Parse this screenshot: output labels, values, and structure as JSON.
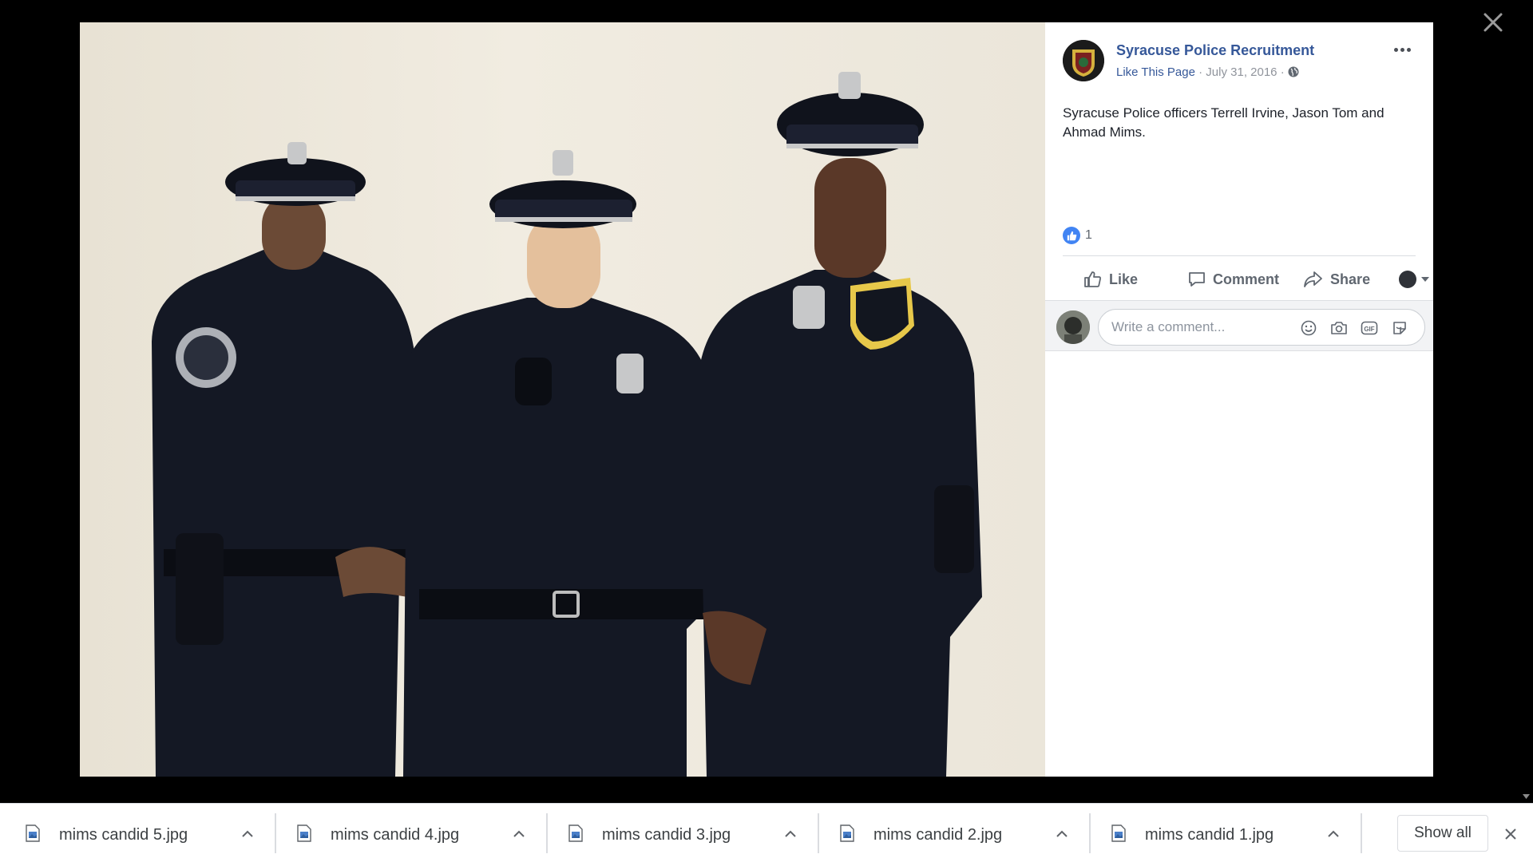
{
  "post": {
    "page_name": "Syracuse Police Recruitment",
    "like_page_label": "Like This Page",
    "separator": " · ",
    "date": "July 31, 2016",
    "caption": "Syracuse Police officers Terrell Irvine, Jason Tom and Ahmad Mims.",
    "reaction_count": "1",
    "actions": {
      "like": "Like",
      "comment": "Comment",
      "share": "Share"
    },
    "comment_placeholder": "Write a comment..."
  },
  "downloads": {
    "items": [
      {
        "name": "mims candid 5.jpg"
      },
      {
        "name": "mims candid 4.jpg"
      },
      {
        "name": "mims candid 3.jpg"
      },
      {
        "name": "mims candid 2.jpg"
      },
      {
        "name": "mims candid 1.jpg"
      }
    ],
    "show_all_label": "Show all"
  },
  "colors": {
    "link": "#365899",
    "like_blue": "#4184f3",
    "uniform": "#141824"
  }
}
